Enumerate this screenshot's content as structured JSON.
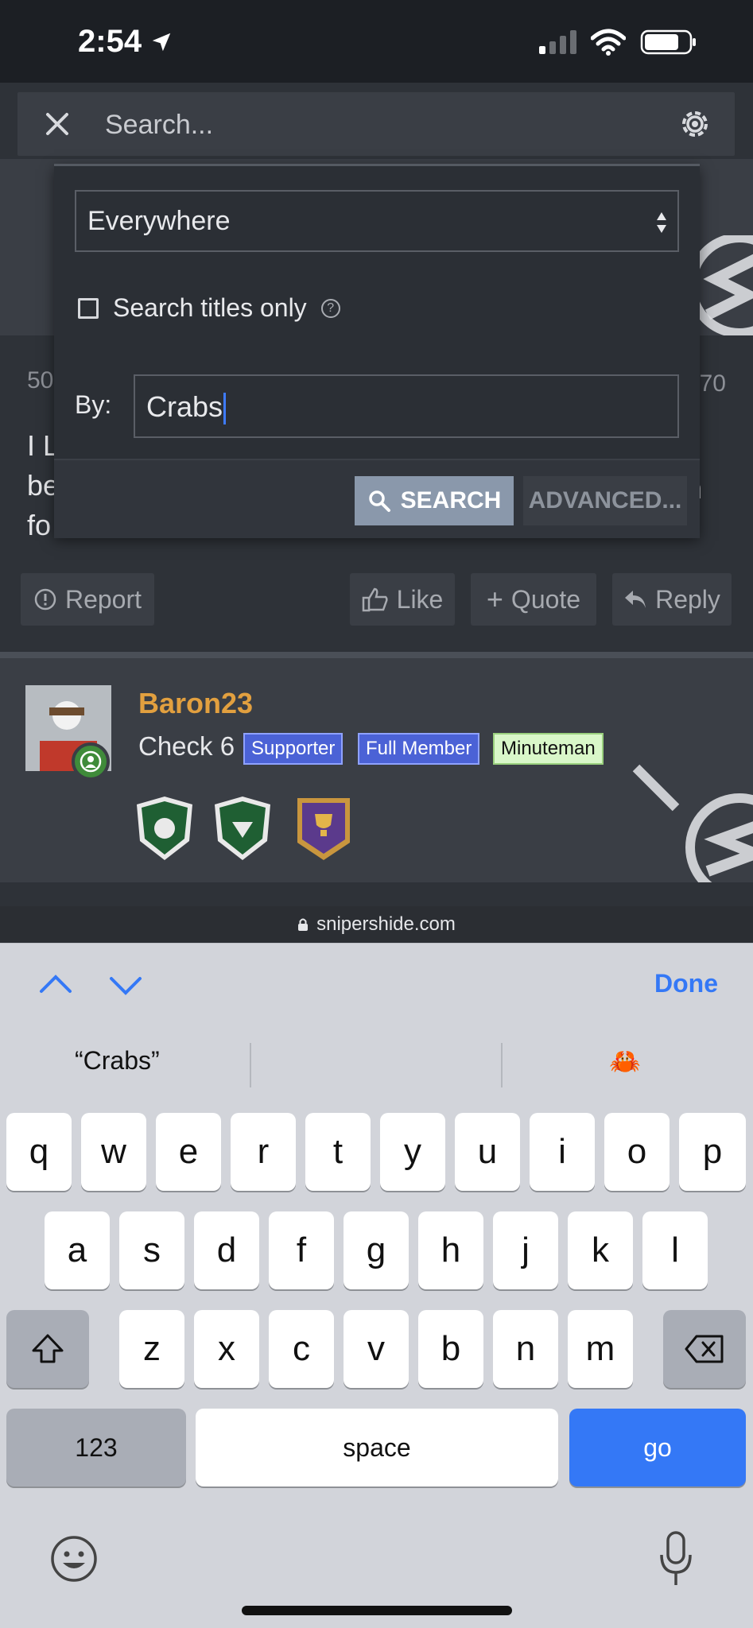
{
  "status": {
    "time": "2:54"
  },
  "search_bar": {
    "placeholder": "Search..."
  },
  "dropdown": {
    "scope": "Everywhere",
    "titles_only_label": "Search titles only",
    "help_glyph": "?",
    "by_label": "By:",
    "by_value": "Crabs",
    "search_button": "SEARCH",
    "advanced_button": "ADVANCED..."
  },
  "post": {
    "num_left": "50",
    "num_right": "70",
    "line1": "I L",
    "line2": "be",
    "line2_right": "n",
    "line3": "fo",
    "actions": {
      "report": "Report",
      "like": "Like",
      "quote": "Quote",
      "reply": "Reply"
    }
  },
  "member": {
    "username": "Baron23",
    "title": "Check 6",
    "tags": [
      "Supporter",
      "Full Member",
      "Minuteman"
    ]
  },
  "browser": {
    "url": "snipershide.com"
  },
  "keyboard": {
    "done": "Done",
    "suggestions": [
      "“Crabs”",
      "",
      "🦀"
    ],
    "row1": [
      "q",
      "w",
      "e",
      "r",
      "t",
      "y",
      "u",
      "i",
      "o",
      "p"
    ],
    "row2": [
      "a",
      "s",
      "d",
      "f",
      "g",
      "h",
      "j",
      "k",
      "l"
    ],
    "row3": [
      "z",
      "x",
      "c",
      "v",
      "b",
      "n",
      "m"
    ],
    "numbers_key": "123",
    "space_key": "space",
    "go_key": "go"
  },
  "colors": {
    "accent_blue": "#3478f6",
    "username_orange": "#e2a03f",
    "tag_blue": "#4b62d6",
    "tag_green": "#d9f7c9"
  }
}
